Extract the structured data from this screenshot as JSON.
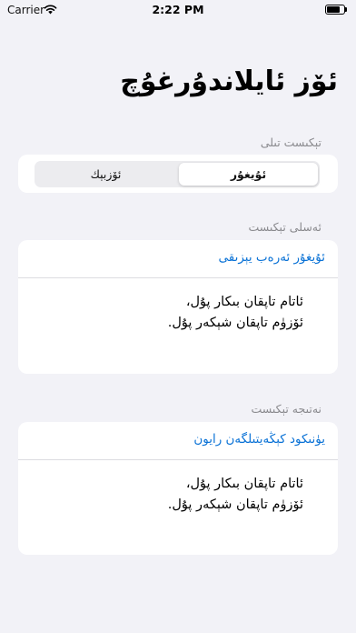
{
  "status_bar": {
    "carrier": "Carrier",
    "time": "2:22 PM",
    "battery_level": 0.85
  },
  "page": {
    "title": "ئۆز ئايلاندۇرغۇچ"
  },
  "language_section": {
    "label": "تېكىست تىلى",
    "options": [
      "ئۇيغۇر",
      "ئۆزبېك"
    ],
    "selected": "ئۇيغۇر"
  },
  "source_section": {
    "label": "ئەسلى تېكىست",
    "script_link": "ئۇيغۇر ئەرەب يېزىقى",
    "lines": [
      "ئاتام تاپقان بىكار پۇل،",
      "ئۆزۈم تاپقان شېكەر پۇل."
    ]
  },
  "result_section": {
    "label": "نەتىجە تېكىست",
    "script_link": "يۈنىكود كېڭەيتىلگەن رايون",
    "lines": [
      "ئاتام تاپقان بىكار پۇل،",
      "ئۆزۈم تاپقان شېكەر پۇل."
    ]
  },
  "colors": {
    "background": "#f2f2f7",
    "accent": "#0a72d6",
    "secondary_label": "#8a8a8e"
  }
}
